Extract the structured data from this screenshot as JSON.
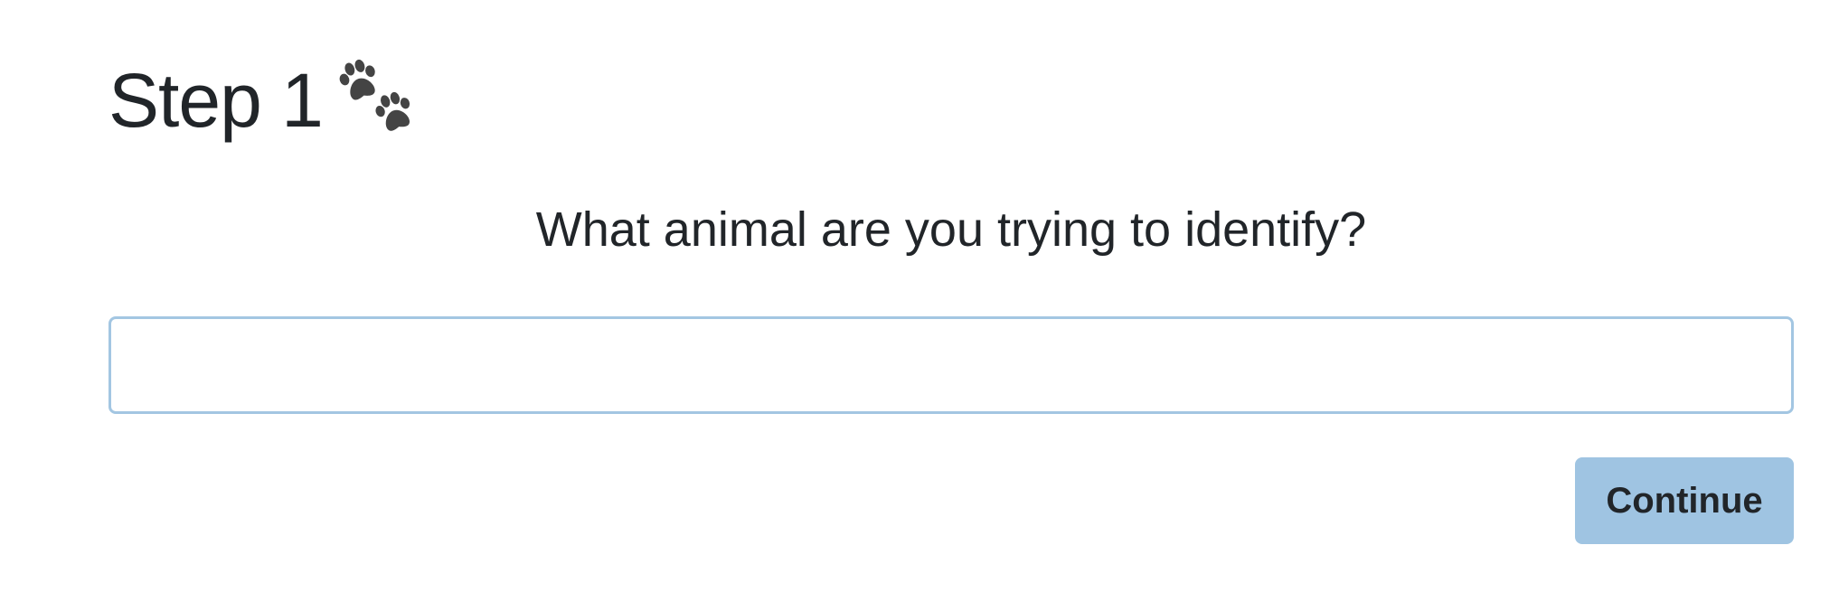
{
  "header": {
    "step_label": "Step 1",
    "icon": "paw-prints-icon"
  },
  "form": {
    "question": "What animal are you trying to identify?",
    "animal_input": {
      "value": "",
      "placeholder": ""
    },
    "continue_label": "Continue"
  },
  "colors": {
    "text": "#212529",
    "input_border": "#a3c6e2",
    "button_bg": "#9fc4e2",
    "icon": "#444444"
  }
}
